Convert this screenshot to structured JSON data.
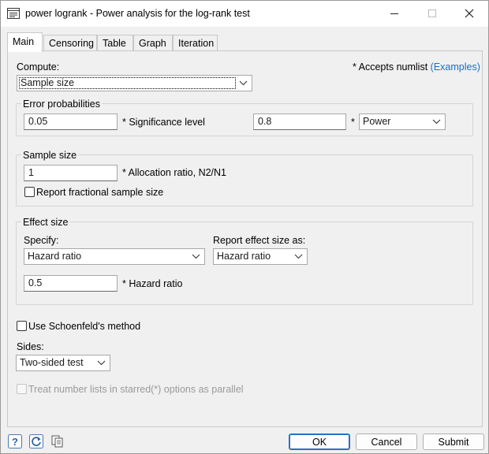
{
  "window": {
    "title": "power logrank - Power analysis for the log-rank test"
  },
  "tabs": [
    {
      "label": "Main",
      "active": true
    },
    {
      "label": "Censoring",
      "active": false
    },
    {
      "label": "Table",
      "active": false
    },
    {
      "label": "Graph",
      "active": false
    },
    {
      "label": "Iteration",
      "active": false
    }
  ],
  "compute": {
    "label": "Compute:",
    "value": "Sample size"
  },
  "numlist": {
    "note": "* Accepts numlist",
    "link": "(Examples)"
  },
  "error_prob": {
    "title": "Error probabilities",
    "alpha_value": "0.05",
    "alpha_label": "* Significance level",
    "power_value": "0.8",
    "star": "*",
    "power_select": "Power"
  },
  "sample_size": {
    "title": "Sample size",
    "ratio_value": "1",
    "ratio_label": "* Allocation ratio, N2/N1",
    "fractional_label": "Report fractional sample size",
    "fractional_checked": false
  },
  "effect_size": {
    "title": "Effect size",
    "specify_label": "Specify:",
    "specify_value": "Hazard ratio",
    "report_label": "Report effect size as:",
    "report_value": "Hazard ratio",
    "hr_value": "0.5",
    "hr_label": "* Hazard ratio"
  },
  "schoenfeld": {
    "label": "Use Schoenfeld's method",
    "checked": false
  },
  "sides": {
    "label": "Sides:",
    "value": "Two-sided test"
  },
  "parallel": {
    "label": "Treat number lists in starred(*) options as parallel",
    "checked": false,
    "disabled": true
  },
  "buttons": {
    "ok": "OK",
    "cancel": "Cancel",
    "submit": "Submit"
  },
  "colors": {
    "link": "#1a6fc4",
    "default_button_border": "#2f6fc0",
    "panel_bg": "#f0f0f0"
  }
}
